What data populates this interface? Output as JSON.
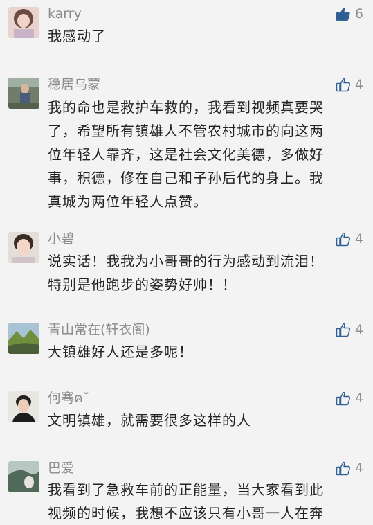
{
  "comments": [
    {
      "name": "karry",
      "likes": "6",
      "liked": true,
      "text": "我感动了"
    },
    {
      "name": "稳居乌蒙",
      "likes": "4",
      "liked": false,
      "text": "我的命也是救护车救的，我看到视频真要哭\n了，希望所有镇雄人不管农村城市的向这两\n位年轻人靠齐，这是社会文化美德，多做好\n事，积德，修在自己和子孙后代的身上。我\n真城为两位年轻人点赞。"
    },
    {
      "name": "小碧",
      "likes": "4",
      "liked": false,
      "text": "说实话！我我为小哥哥的行为感动到流泪！\n特别是他跑步的姿势好帅！！"
    },
    {
      "name": "青山常在(轩衣阁)",
      "likes": "4",
      "liked": false,
      "text": "大镇雄好人还是多呢！"
    },
    {
      "name": "何骞ฅ˘",
      "likes": "4",
      "liked": false,
      "text": "文明镇雄，就需要很多这样的人"
    },
    {
      "name": "巴爱",
      "likes": "4",
      "liked": false,
      "text": "我看到了急救车前的正能量，当大家看到此\n视频的时候，我想不应该只有小哥一人在奔"
    }
  ],
  "colors": {
    "background": "#f3f3f3",
    "name": "#8c8c8c",
    "text": "#222222",
    "like_active": "#2f5f93",
    "like_idle": "#2f5f93"
  },
  "icons": {
    "like_filled": "thumbs-up-filled-icon",
    "like_outline": "thumbs-up-outline-icon"
  }
}
